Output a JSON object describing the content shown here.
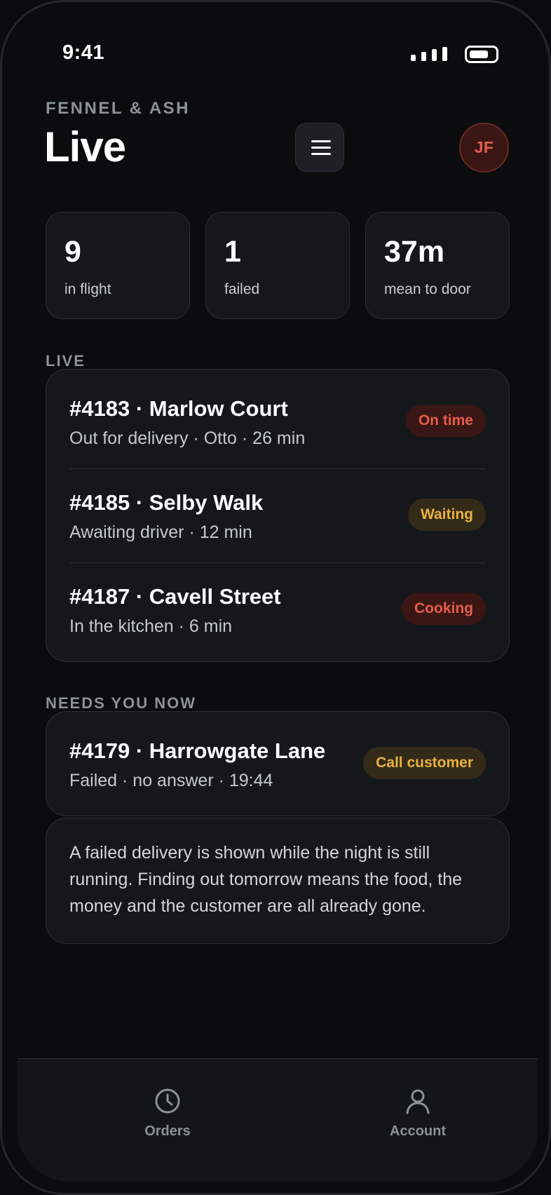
{
  "status_bar": {
    "time": "9:41"
  },
  "header": {
    "brand": "FENNEL & ASH",
    "title": "Live",
    "avatar_initials": "JF"
  },
  "stats": [
    {
      "value": "9",
      "label": "in flight"
    },
    {
      "value": "1",
      "label": "failed"
    },
    {
      "value": "37m",
      "label": "mean to door"
    }
  ],
  "live": {
    "section_label": "LIVE",
    "orders": [
      {
        "title": "#4183 · Marlow Court",
        "subtitle": "Out for delivery · Otto · 26 min",
        "status": "On time",
        "status_color": "#e45d4b"
      },
      {
        "title": "#4185 · Selby Walk",
        "subtitle": "Awaiting driver · 12 min",
        "status": "Waiting",
        "status_color": "#e8b23e"
      },
      {
        "title": "#4187 · Cavell Street",
        "subtitle": "In the kitchen · 6 min",
        "status": "Cooking",
        "status_color": "#e45d4b"
      }
    ]
  },
  "needs_you": {
    "section_label": "NEEDS YOU NOW",
    "order": {
      "title": "#4179 · Harrowgate Lane",
      "subtitle": "Failed · no answer · 19:44",
      "action": "Call customer",
      "action_color": "#e8b23e"
    },
    "note": "A failed delivery is shown while the night is still running. Finding out tomorrow means the food, the money and the customer are all already gone."
  },
  "tab_bar": {
    "tabs": [
      {
        "label": "Orders",
        "icon": "clock-icon"
      },
      {
        "label": "Account",
        "icon": "person-icon"
      }
    ]
  },
  "colors": {
    "background": "#0b0c0e",
    "card": "#15181b",
    "accent_red": "#e45d4b",
    "accent_amber": "#e8b23e",
    "muted": "#8a9398"
  }
}
